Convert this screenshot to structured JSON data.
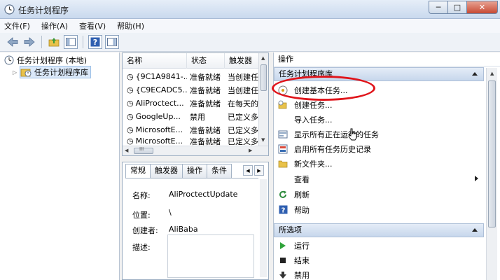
{
  "window": {
    "title": "任务计划程序",
    "controls": {
      "minimize": "─",
      "maximize": "□",
      "close": "✕"
    }
  },
  "menubar": {
    "items": [
      "文件(F)",
      "操作(A)",
      "查看(V)",
      "帮助(H)"
    ]
  },
  "tree": {
    "root": "任务计划程序 (本地)",
    "child": "任务计划程序库"
  },
  "task_list": {
    "headers": [
      "名称",
      "状态",
      "触发器"
    ],
    "rows": [
      {
        "name": "{9C1A9841-...",
        "status": "准备就绪",
        "trigger": "当创建任"
      },
      {
        "name": "{C9ECADC5...",
        "status": "准备就绪",
        "trigger": "当创建任"
      },
      {
        "name": "AliProctect...",
        "status": "准备就绪",
        "trigger": "在每天的"
      },
      {
        "name": "GoogleUp...",
        "status": "禁用",
        "trigger": "已定义多"
      },
      {
        "name": "MicrosoftE...",
        "status": "准备就绪",
        "trigger": "已定义多"
      },
      {
        "name": "MicrosoftE...",
        "status": "准备就绪",
        "trigger": "已定义多"
      }
    ],
    "hscroll_grip": "III"
  },
  "detail": {
    "tabs": [
      "常规",
      "触发器",
      "操作",
      "条件"
    ],
    "tab_arrows": [
      "◀",
      "▶"
    ],
    "fields": {
      "name_label": "名称:",
      "name_value": "AliProctectUpdate",
      "location_label": "位置:",
      "location_value": "\\",
      "author_label": "创建者:",
      "author_value": "AliBaba",
      "desc_label": "描述:"
    }
  },
  "actions": {
    "title": "操作",
    "section1": "任务计划程序库",
    "items": [
      {
        "label": "创建基本任务...",
        "icon": "clock-wizard-icon"
      },
      {
        "label": "创建任务...",
        "icon": "folder-clock-icon"
      },
      {
        "label": "导入任务...",
        "icon": "blank-icon"
      },
      {
        "label": "显示所有正在运行的任务",
        "icon": "running-tasks-icon"
      },
      {
        "label": "启用所有任务历史记录",
        "icon": "history-icon"
      },
      {
        "label": "新文件夹...",
        "icon": "folder-icon"
      },
      {
        "label": "查看",
        "icon": "blank-icon"
      },
      {
        "label": "刷新",
        "icon": "refresh-icon"
      },
      {
        "label": "帮助",
        "icon": "help-icon"
      }
    ],
    "section2": "所选项",
    "selected_items": [
      {
        "label": "运行",
        "icon": "run-icon"
      },
      {
        "label": "结束",
        "icon": "end-icon"
      },
      {
        "label": "禁用",
        "icon": "disable-icon"
      }
    ]
  },
  "colors": {
    "accent": "#3a6fb5",
    "highlight": "#e0151b",
    "section_bg": "#c7d7ec"
  }
}
